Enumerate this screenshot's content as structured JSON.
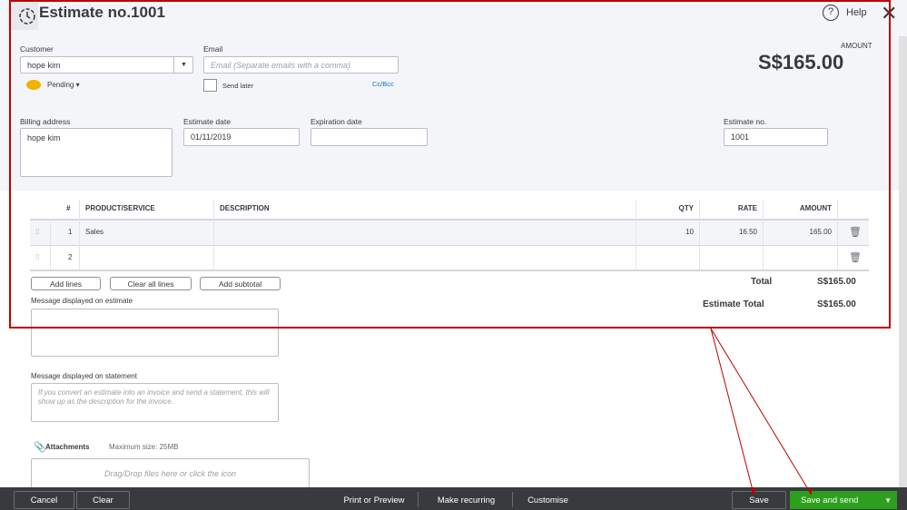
{
  "header": {
    "title": "Estimate no.1001",
    "help": "Help",
    "amount_label": "AMOUNT",
    "amount": "S$165.00"
  },
  "customer": {
    "label": "Customer",
    "value": "hope kim",
    "status": "Pending"
  },
  "email": {
    "label": "Email",
    "placeholder": "Email (Separate emails with a comma)",
    "send_later": "Send later",
    "cc_bcc": "Cc/Bcc"
  },
  "billing": {
    "label": "Billing address",
    "value": "hope kim"
  },
  "estimate_date": {
    "label": "Estimate date",
    "value": "01/11/2019"
  },
  "expiration_date": {
    "label": "Expiration date",
    "value": ""
  },
  "estimate_no": {
    "label": "Estimate no.",
    "value": "1001"
  },
  "table": {
    "columns": [
      "#",
      "PRODUCT/SERVICE",
      "DESCRIPTION",
      "QTY",
      "RATE",
      "AMOUNT"
    ],
    "rows": [
      {
        "n": "1",
        "product": "Sales",
        "description": "",
        "qty": "10",
        "rate": "16.50",
        "amount": "165.00"
      },
      {
        "n": "2",
        "product": "",
        "description": "",
        "qty": "",
        "rate": "",
        "amount": ""
      }
    ]
  },
  "actions": {
    "add_lines": "Add lines",
    "clear_all": "Clear all lines",
    "add_subtotal": "Add subtotal"
  },
  "totals": {
    "total_label": "Total",
    "total": "S$165.00",
    "estimate_total_label": "Estimate Total",
    "estimate_total": "S$165.00"
  },
  "message_estimate": {
    "label": "Message displayed on estimate"
  },
  "message_statement": {
    "label": "Message displayed on statement",
    "placeholder": "If you convert an estimate into an invoice and send a statement, this will show up as the description for the invoice."
  },
  "attachments": {
    "label": "Attachments",
    "max": "Maximum size: 25MB",
    "drop": "Drag/Drop files here or click the icon"
  },
  "footer": {
    "cancel": "Cancel",
    "clear": "Clear",
    "print": "Print or Preview",
    "recurring": "Make recurring",
    "customise": "Customise",
    "save": "Save",
    "save_send": "Save and send"
  },
  "colors": {
    "green": "#2ca01c",
    "annotation": "#c00000",
    "link": "#0077c5"
  }
}
